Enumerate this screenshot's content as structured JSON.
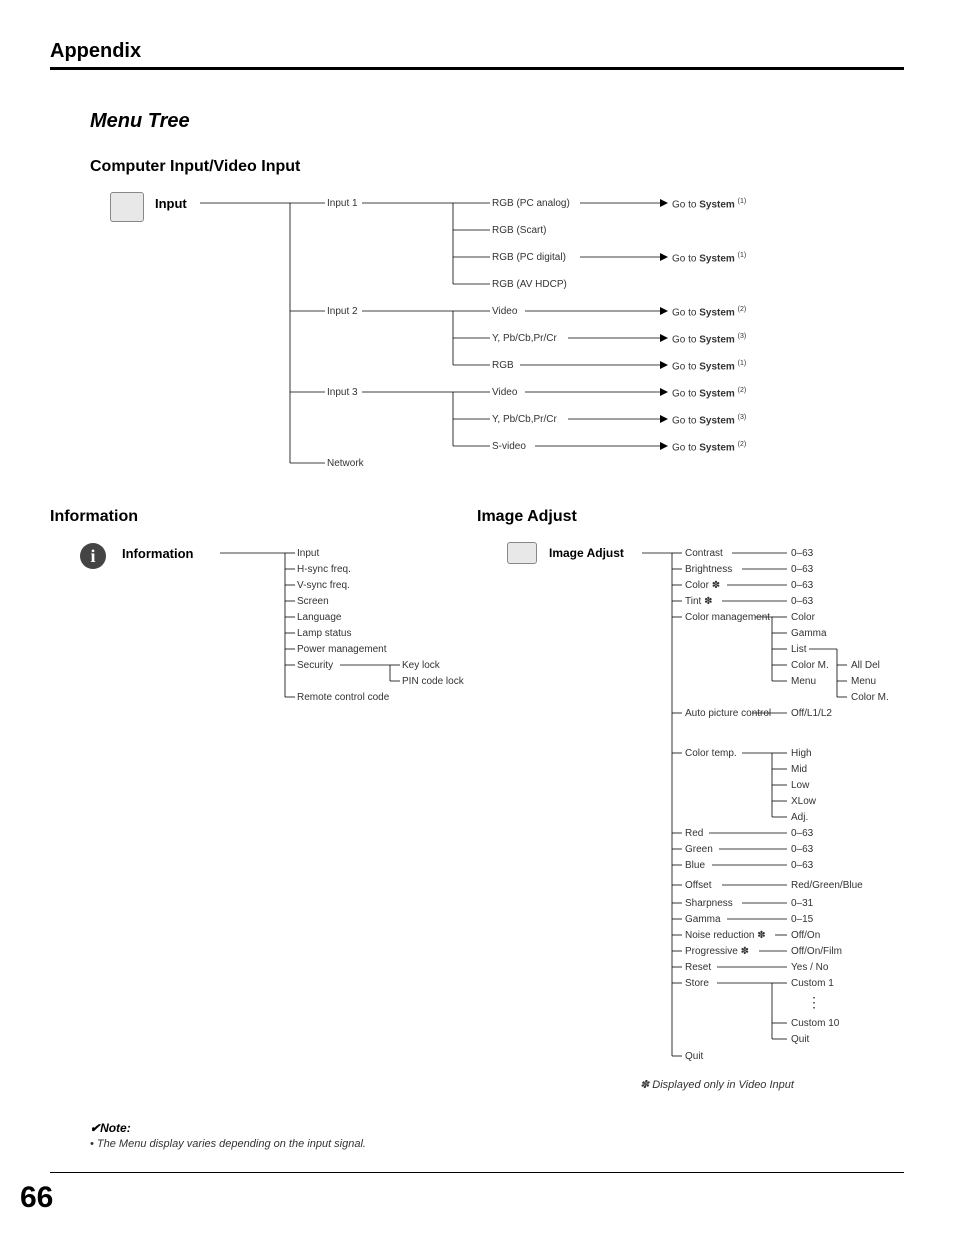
{
  "appendix_title": "Appendix",
  "menu_tree_title": "Menu Tree",
  "section1_title": "Computer Input/Video Input",
  "input_root": "Input",
  "input1": "Input 1",
  "input2": "Input 2",
  "input3": "Input 3",
  "network": "Network",
  "rgb_pc_analog": "RGB (PC analog)",
  "rgb_scart": "RGB (Scart)",
  "rgb_pc_digital": "RGB (PC digital)",
  "rgb_av_hdcp": "RGB (AV HDCP)",
  "video": "Video",
  "ypbcb": "Y, Pb/Cb,Pr/Cr",
  "rgb": "RGB",
  "svideo": "S-video",
  "goto_system": "Go to ",
  "system_word": "System",
  "sup1": "(1)",
  "sup2": "(2)",
  "sup3": "(3)",
  "information_title": "Information",
  "information_root": "Information",
  "info_input": "Input",
  "info_hsync": "H-sync freq.",
  "info_vsync": "V-sync freq.",
  "info_screen": "Screen",
  "info_lang": "Language",
  "info_lamp": "Lamp status",
  "info_power": "Power management",
  "info_security": "Security",
  "info_keylock": "Key lock",
  "info_pinlock": "PIN code lock",
  "info_remote": "Remote control code",
  "image_adjust_title": "Image Adjust",
  "image_adjust_root": "Image Adjust",
  "ia_contrast": "Contrast",
  "ia_brightness": "Brightness",
  "ia_color": "Color",
  "ia_tint": "Tint",
  "ia_colormgmt": "Color management",
  "ia_cm_color": "Color",
  "ia_cm_gamma": "Gamma",
  "ia_cm_list": "List",
  "ia_cm_colorm": "Color M.",
  "ia_cm_menu": "Menu",
  "ia_cm_alldel": "All Del",
  "ia_cm_menu2": "Menu",
  "ia_cm_colorm2": "Color M.",
  "ia_autopic": "Auto picture control",
  "ia_autopic_val": "Off/L1/L2",
  "ia_colortemp": "Color temp.",
  "ia_ct_high": "High",
  "ia_ct_mid": "Mid",
  "ia_ct_low": "Low",
  "ia_ct_xlow": "XLow",
  "ia_ct_adj": "Adj.",
  "ia_red": "Red",
  "ia_green": "Green",
  "ia_blue": "Blue",
  "ia_offset": "Offset",
  "ia_offset_val": "Red/Green/Blue",
  "ia_sharp": "Sharpness",
  "ia_gamma": "Gamma",
  "ia_noise": "Noise reduction",
  "ia_noise_val": "Off/On",
  "ia_prog": "Progressive",
  "ia_prog_val": "Off/On/Film",
  "ia_reset": "Reset",
  "ia_reset_val": "Yes / No",
  "ia_store": "Store",
  "ia_store_c1": "Custom 1",
  "ia_store_c10": "Custom 10",
  "ia_store_quit": "Quit",
  "ia_quit": "Quit",
  "r_0_63": "0–63",
  "r_0_31": "0–31",
  "r_0_15": "0–15",
  "footnote": "Displayed only in Video Input",
  "note_title": "Note:",
  "note_text": "• The Menu display varies depending on the input signal.",
  "page_number": "66",
  "star": "✽",
  "check": "✔"
}
